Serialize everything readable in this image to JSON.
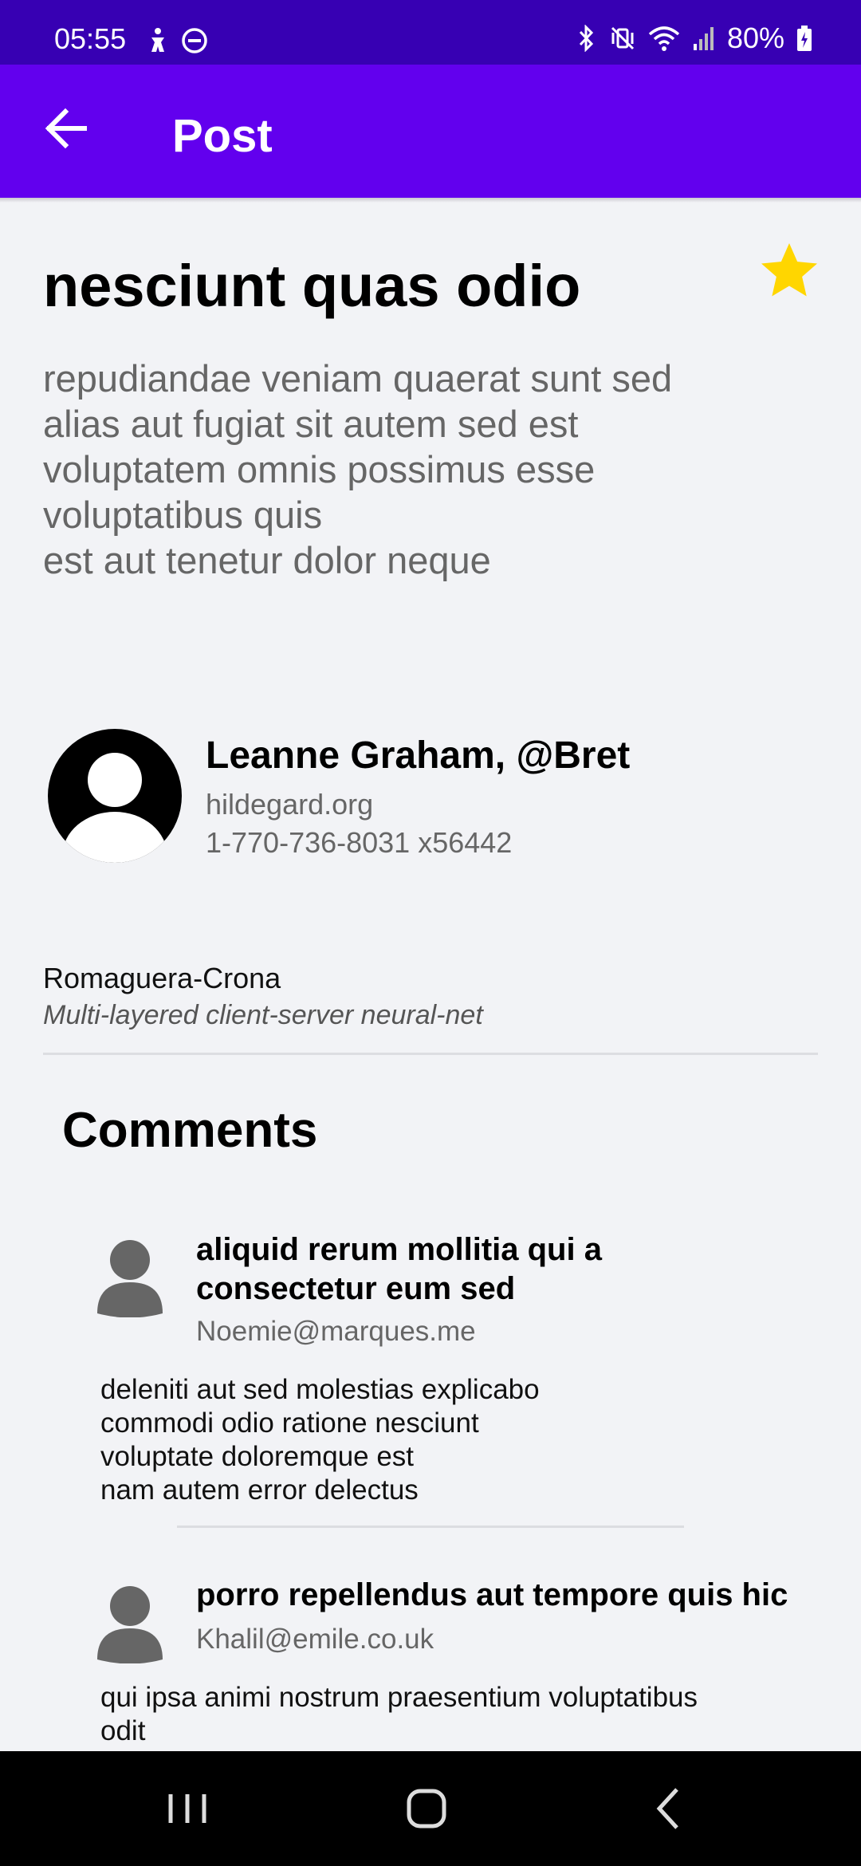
{
  "status_bar": {
    "time": "05:55",
    "battery": "80%",
    "left_icons": [
      "accessibility-icon",
      "do-not-disturb-icon"
    ],
    "right_icons": [
      "bluetooth-icon",
      "vibrate-mute-icon",
      "wifi-icon",
      "signal-icon",
      "battery-charging-icon"
    ]
  },
  "app_bar": {
    "title": "Post",
    "back_icon": "arrow-left-icon",
    "color": "#6200ee",
    "status_color": "#3700b3"
  },
  "post": {
    "title": "nesciunt quas odio",
    "favorite_icon": "star-icon",
    "favorite_color": "#ffd600",
    "body": "repudiandae veniam quaerat sunt sed\nalias aut fugiat sit autem sed est\nvoluptatem omnis possimus esse\nvoluptatibus quis\nest aut tenetur dolor neque"
  },
  "author": {
    "name": "Leanne Graham, @Bret",
    "website": "hildegard.org",
    "phone": "1-770-736-8031 x56442",
    "company": "Romaguera-Crona",
    "catch_phrase": "Multi-layered client-server neural-net"
  },
  "comments": {
    "heading": "Comments",
    "items": [
      {
        "title": "aliquid rerum mollitia qui a\nconsectetur eum sed",
        "email": "Noemie@marques.me",
        "body": "deleniti aut sed molestias explicabo\ncommodi odio ratione nesciunt\nvoluptate doloremque est\nnam autem error delectus"
      },
      {
        "title": "porro repellendus aut tempore quis hic",
        "email": "Khalil@emile.co.uk",
        "body": "qui ipsa animi nostrum praesentium voluptatibus\nodit"
      }
    ]
  },
  "nav_bar": {
    "buttons": [
      "recent-apps-icon",
      "home-icon",
      "back-icon"
    ]
  }
}
